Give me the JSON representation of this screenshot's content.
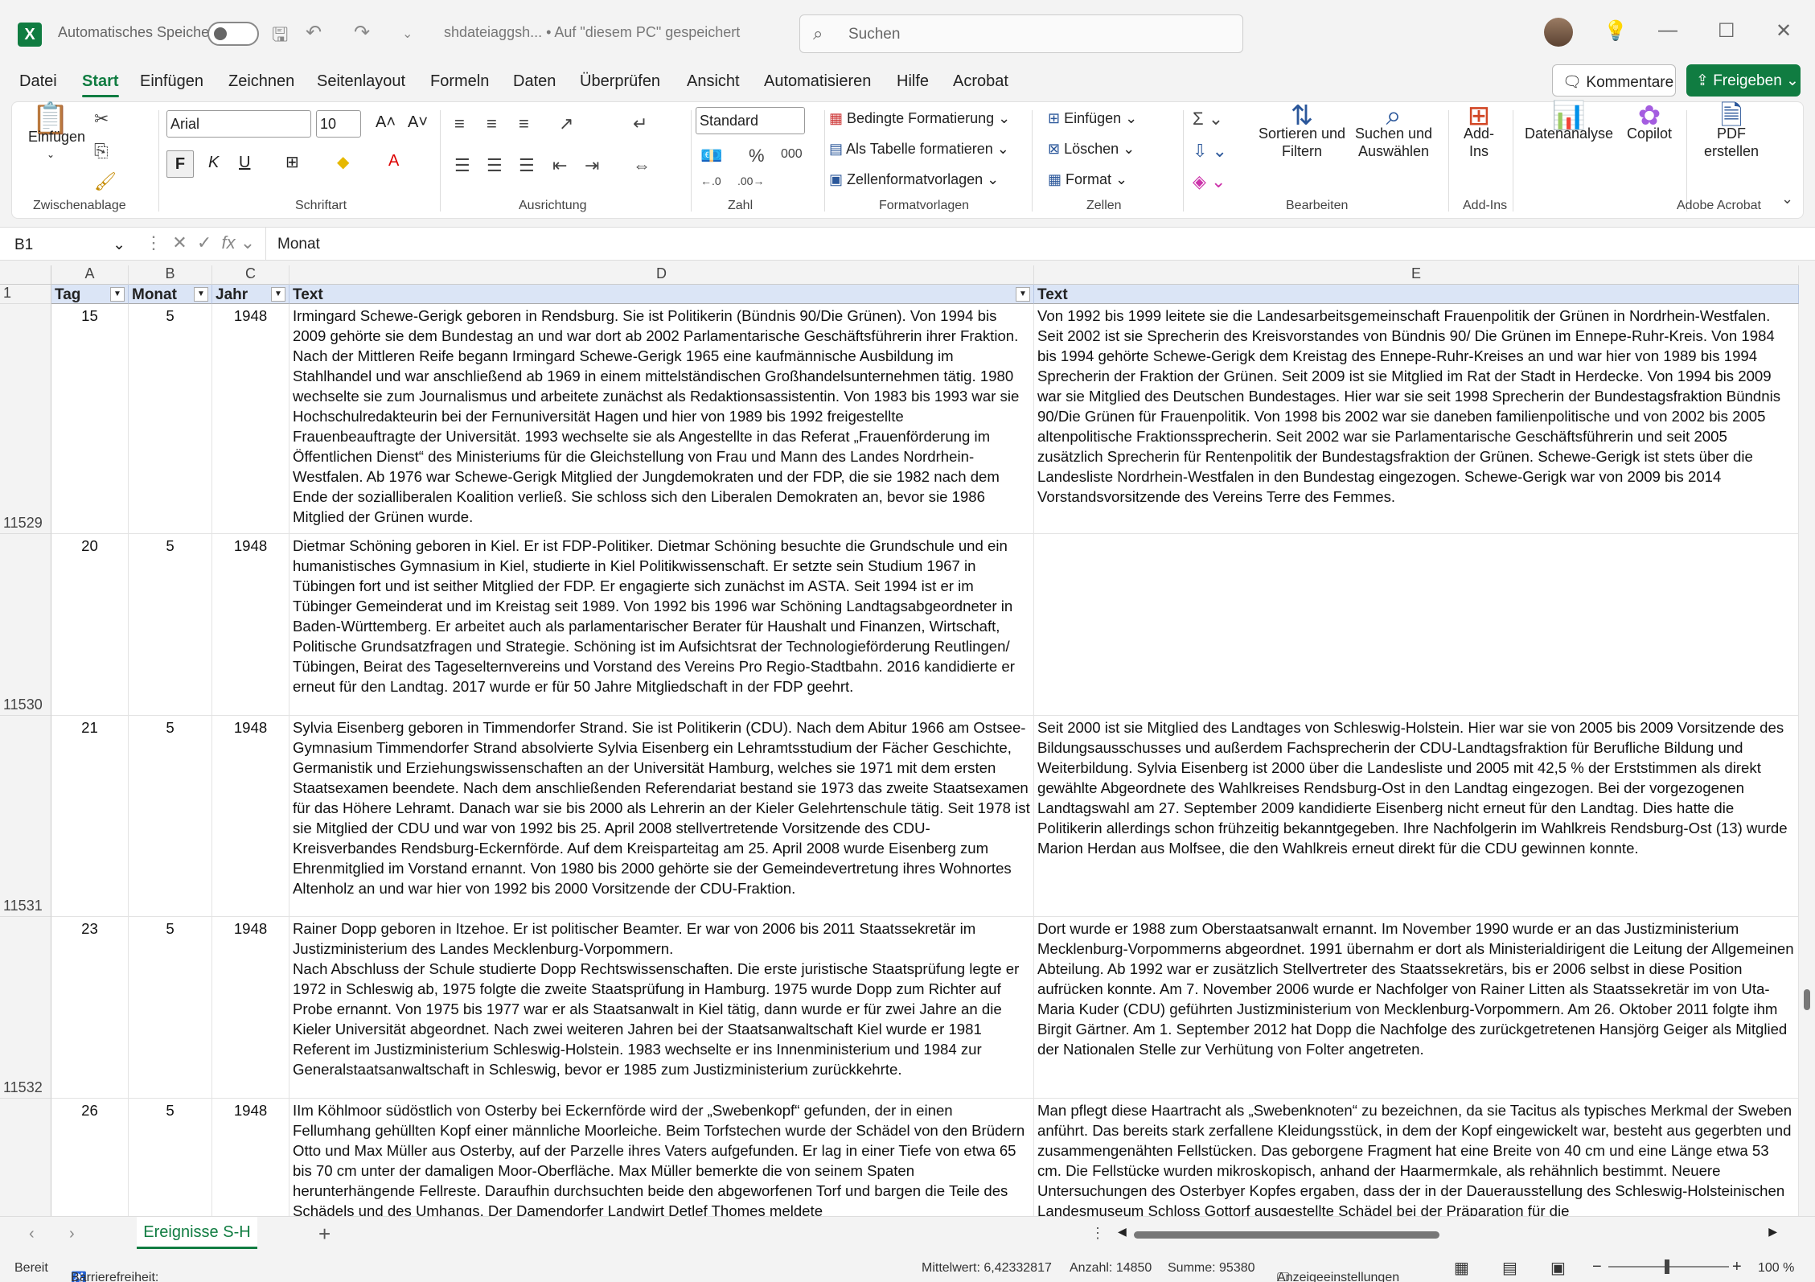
{
  "titlebar": {
    "app_icon": "excel-logo",
    "autosave_label": "Automatisches Speichern",
    "doc_title": "shdateiaggsh... • Auf \"diesem PC\" gespeichert",
    "search_placeholder": "Suchen"
  },
  "tabs": [
    "Datei",
    "Start",
    "Einfügen",
    "Zeichnen",
    "Seitenlayout",
    "Formeln",
    "Daten",
    "Überprüfen",
    "Ansicht",
    "Automatisieren",
    "Hilfe",
    "Acrobat"
  ],
  "active_tab": "Start",
  "actions": {
    "comments": "Kommentare",
    "share": "Freigeben"
  },
  "ribbon": {
    "clipboard": {
      "paste": "Einfügen",
      "label": "Zwischenablage"
    },
    "font": {
      "name": "Arial",
      "size": "10",
      "bold": "F",
      "italic": "K",
      "underline": "U",
      "label": "Schriftart"
    },
    "alignment": {
      "label": "Ausrichtung"
    },
    "number": {
      "format": "Standard",
      "label": "Zahl",
      "percent": "%",
      "thousands": "000"
    },
    "styles": {
      "conditional": "Bedingte Formatierung",
      "as_table": "Als Tabelle formatieren",
      "cell_styles": "Zellenformatvorlagen",
      "label": "Formatvorlagen"
    },
    "cells": {
      "insert": "Einfügen",
      "delete": "Löschen",
      "format": "Format",
      "label": "Zellen"
    },
    "editing": {
      "sort_filter": "Sortieren und Filtern",
      "find_select": "Suchen und Auswählen",
      "label": "Bearbeiten"
    },
    "addins": {
      "addins": "Add-Ins",
      "label": "Add-Ins"
    },
    "analysis": {
      "data_analysis": "Datenanalyse",
      "copilot": "Copilot"
    },
    "acrobat": {
      "create_pdf": "PDF erstellen",
      "label": "Adobe Acrobat"
    }
  },
  "formula_bar": {
    "cell_ref": "B1",
    "fx": "fx",
    "content": "Monat"
  },
  "columns": [
    "A",
    "B",
    "C",
    "D",
    "E"
  ],
  "header_row": {
    "row_num": "1",
    "a": "Tag",
    "b": "Monat",
    "c": "Jahr",
    "d": "Text",
    "e": "Text"
  },
  "rows": [
    {
      "row_num": "11529",
      "tag": "15",
      "monat": "5",
      "jahr": "1948",
      "d": "Irmingard Schewe-Gerigk geboren  in Rendsburg. Sie  ist   Politikerin (Bündnis 90/Die Grünen). Von 1994 bis 2009 gehörte sie dem Bundestag an und war dort ab 2002 Parlamentarische Geschäftsführerin ihrer Fraktion. Nach der Mittleren Reife begann Irmingard Schewe-Gerigk 1965 eine kaufmännische Ausbildung im Stahlhandel und war anschließend ab 1969 in einem mittelständischen Großhandelsunternehmen tätig. 1980 wechselte sie zum Journalismus und arbeitete zunächst als Redaktionsassistentin. Von 1983 bis 1993 war sie Hochschulredakteurin bei der Fernuniversität Hagen und hier von 1989 bis 1992 freigestellte Frauenbeauftragte der Universität. 1993 wechselte sie als Angestellte in das Referat „Frauenförderung im Öffentlichen Dienst“ des Ministeriums für die Gleichstellung von Frau und Mann des Landes Nordrhein-Westfalen. Ab 1976 war Schewe-Gerigk Mitglied der Jungdemokraten und der FDP, die sie 1982 nach dem Ende der sozialliberalen Koalition verließ. Sie schloss sich den Liberalen Demokraten an, bevor sie 1986 Mitglied der Grünen wurde.",
      "e": "Von 1992 bis 1999 leitete sie die Landesarbeitsgemeinschaft Frauenpolitik der Grünen in Nordrhein-Westfalen. Seit 2002 ist sie Sprecherin des Kreisvorstandes von Bündnis 90/ Die Grünen im Ennepe-Ruhr-Kreis. Von 1984 bis 1994 gehörte Schewe-Gerigk dem Kreistag des Ennepe-Ruhr-Kreises an und war hier von 1989 bis 1994 Sprecherin der Fraktion der Grünen. Seit 2009 ist sie Mitglied im Rat der Stadt in Herdecke. Von 1994 bis 2009 war sie Mitglied des Deutschen Bundestages. Hier war sie seit 1998 Sprecherin der Bundestagsfraktion Bündnis 90/Die Grünen für Frauenpolitik. Von 1998 bis 2002 war sie daneben familienpolitische und von 2002 bis 2005 altenpolitische Fraktionssprecherin. Seit 2002 war sie Parlamentarische Geschäftsführerin und seit 2005 zusätzlich Sprecherin für Rentenpolitik der Bundestagsfraktion der Grünen. Schewe-Gerigk ist stets über die Landesliste Nordrhein-Westfalen in den Bundestag eingezogen. Schewe-Gerigk war von 2009 bis 2014 Vorstandsvorsitzende des Vereins Terre des Femmes."
    },
    {
      "row_num": "11530",
      "tag": "20",
      "monat": "5",
      "jahr": "1948",
      "d": "Dietmar Schöning geboren  in Kiel. Er ist   FDP-Politiker. Dietmar Schöning  besuchte die Grundschule und ein humanistisches Gymnasium in Kiel, studierte in Kiel Politikwissenschaft. Er setzte sein Studium 1967 in Tübingen fort und ist seither Mitglied der FDP. Er engagierte sich zunächst im ASTA. Seit 1994 ist er im Tübinger Gemeinderat und im Kreistag seit 1989. Von 1992 bis 1996 war Schöning Landtagsabgeordneter in Baden-Württemberg. Er arbeitet auch als parlamentarischer Berater für Haushalt und Finanzen, Wirtschaft, Politische Grundsatzfragen und Strategie. Schöning ist im Aufsichtsrat der Technologieförderung Reutlingen/ Tübingen, Beirat des Tageselternvereins und Vorstand des Vereins Pro Regio-Stadtbahn. 2016 kandidierte er erneut für den Landtag.  2017 wurde er für 50 Jahre Mitgliedschaft in der FDP geehrt.",
      "e": ""
    },
    {
      "row_num": "11531",
      "tag": "21",
      "monat": "5",
      "jahr": "1948",
      "d": "Sylvia Eisenberg geboren in Timmendorfer Strand. Sie  ist   Politikerin (CDU). Nach dem Abitur 1966 am Ostsee-Gymnasium Timmendorfer Strand absolvierte Sylvia Eisenberg ein Lehramtsstudium der Fächer Geschichte, Germanistik und Erziehungswissenschaften an der Universität Hamburg, welches sie 1971 mit dem ersten Staatsexamen beendete. Nach dem anschließenden Referendariat bestand sie 1973 das zweite Staatsexamen für das Höhere Lehramt. Danach war sie bis 2000 als Lehrerin an der Kieler Gelehrtenschule tätig. Seit 1978 ist sie Mitglied der CDU und war von 1992 bis 25. April 2008 stellvertretende Vorsitzende des CDU-Kreisverbandes Rendsburg-Eckernförde. Auf dem Kreisparteitag am 25. April 2008 wurde Eisenberg zum Ehrenmitglied im Vorstand ernannt. Von 1980 bis 2000 gehörte sie der Gemeindevertretung ihres Wohnortes Altenholz an und war hier von 1992 bis 2000 Vorsitzende der CDU-Fraktion.",
      "e": "Seit 2000 ist sie Mitglied des Landtages von Schleswig-Holstein. Hier war sie von 2005 bis 2009 Vorsitzende des Bildungsausschusses und außerdem Fachsprecherin der CDU-Landtagsfraktion für Berufliche Bildung und Weiterbildung. Sylvia Eisenberg ist 2000 über die Landesliste und 2005 mit 42,5 % der Erststimmen als direkt gewählte Abgeordnete des Wahlkreises Rendsburg-Ost in den Landtag eingezogen. Bei der vorgezogenen Landtagswahl am 27. September 2009 kandidierte Eisenberg nicht erneut für den Landtag. Dies hatte die Politikerin allerdings schon frühzeitig bekanntgegeben. Ihre Nachfolgerin im Wahlkreis Rendsburg-Ost (13) wurde Marion Herdan aus Molfsee, die den Wahlkreis erneut direkt für die CDU gewinnen konnte."
    },
    {
      "row_num": "11532",
      "tag": "23",
      "monat": "5",
      "jahr": "1948",
      "d": "Rainer Dopp geboren  in Itzehoe. Er  ist   politischer Beamter. Er war von 2006 bis 2011 Staatssekretär im Justizministerium des Landes Mecklenburg-Vorpommern.\nNach Abschluss der Schule studierte Dopp Rechtswissenschaften. Die erste juristische Staatsprüfung legte er 1972 in Schleswig ab, 1975 folgte die zweite Staatsprüfung in Hamburg. 1975 wurde Dopp zum Richter auf Probe ernannt. Von 1975 bis 1977 war er als Staatsanwalt in Kiel tätig, dann wurde er für zwei Jahre an die Kieler Universität abgeordnet. Nach zwei weiteren Jahren bei der Staatsanwaltschaft Kiel wurde er 1981 Referent im Justizministerium Schleswig-Holstein. 1983 wechselte er ins Innenministerium und 1984 zur Generalstaatsanwaltschaft in Schleswig, bevor er 1985 zum Justizministerium zurückkehrte.",
      "e": " Dort wurde er 1988 zum Oberstaatsanwalt ernannt. Im November 1990 wurde er an das Justizministerium Mecklenburg-Vorpommerns abgeordnet. 1991 übernahm er dort als Ministerialdirigent die Leitung der Allgemeinen Abteilung. Ab 1992 war er zusätzlich Stellvertreter des Staatssekretärs, bis er 2006 selbst in diese Position aufrücken konnte. Am 7. November 2006 wurde er Nachfolger von Rainer Litten  als Staatssekretär im von Uta-Maria Kuder (CDU) geführten Justizministerium von Mecklenburg-Vorpommern. Am 26. Oktober 2011 folgte ihm Birgit Gärtner. Am 1. September 2012 hat Dopp die Nachfolge des zurückgetretenen Hansjörg Geiger als Mitglied der Nationalen Stelle zur Verhütung von Folter angetreten."
    },
    {
      "row_num": "",
      "tag": "26",
      "monat": "5",
      "jahr": "1948",
      "d": "IIm Köhlmoor südöstlich von Osterby bei Eckernförde wird der „Swebenkopf“ gefunden, der in einen Fellumhang gehüllten Kopf einer männliche Moorleiche. Beim Torfstechen wurde der Schädel von den Brüdern Otto und Max Müller aus Osterby, auf der Parzelle ihres Vaters aufgefunden. Er lag in einer Tiefe von etwa 65 bis 70 cm unter der damaligen Moor-Oberfläche. Max Müller bemerkte die von seinem Spaten herunterhängende Fellreste. Daraufhin durchsuchten beide den abgeworfenen Torf und bargen die Teile des Schädels und des Umhangs. Der Damendorfer Landwirt Detlef Thomes meldete",
      "e": "Man pflegt diese Haartracht als „Swebenknoten“ zu bezeichnen, da sie Tacitus als typisches Merkmal der Sweben anführt. Das bereits stark zerfallene Kleidungsstück, in dem der Kopf eingewickelt war, besteht aus gegerbten und zusammengenähten Fellstücken. Das geborgene Fragment hat eine Breite von 40 cm und eine Länge etwa 53 cm. Die Fellstücke wurden mikroskopisch, anhand der Haarmermkale, als rehähnlich bestimmt. Neuere Untersuchungen des Osterbyer Kopfes ergaben, dass der in der Dauerausstellung des Schleswig-Holsteinischen Landesmuseum Schloss Gottorf ausgestellte Schädel bei der Präparation für die"
    }
  ],
  "sheet_tab": "Ereignisse S-H",
  "status": {
    "ready": "Bereit",
    "accessibility": "Barrierefreiheit: Keine Probleme",
    "average": "Mittelwert: 6,42332817",
    "count": "Anzahl: 14850",
    "sum": "Summe: 95380",
    "display_settings": "Anzeigeeinstellungen",
    "zoom": "100 %"
  }
}
